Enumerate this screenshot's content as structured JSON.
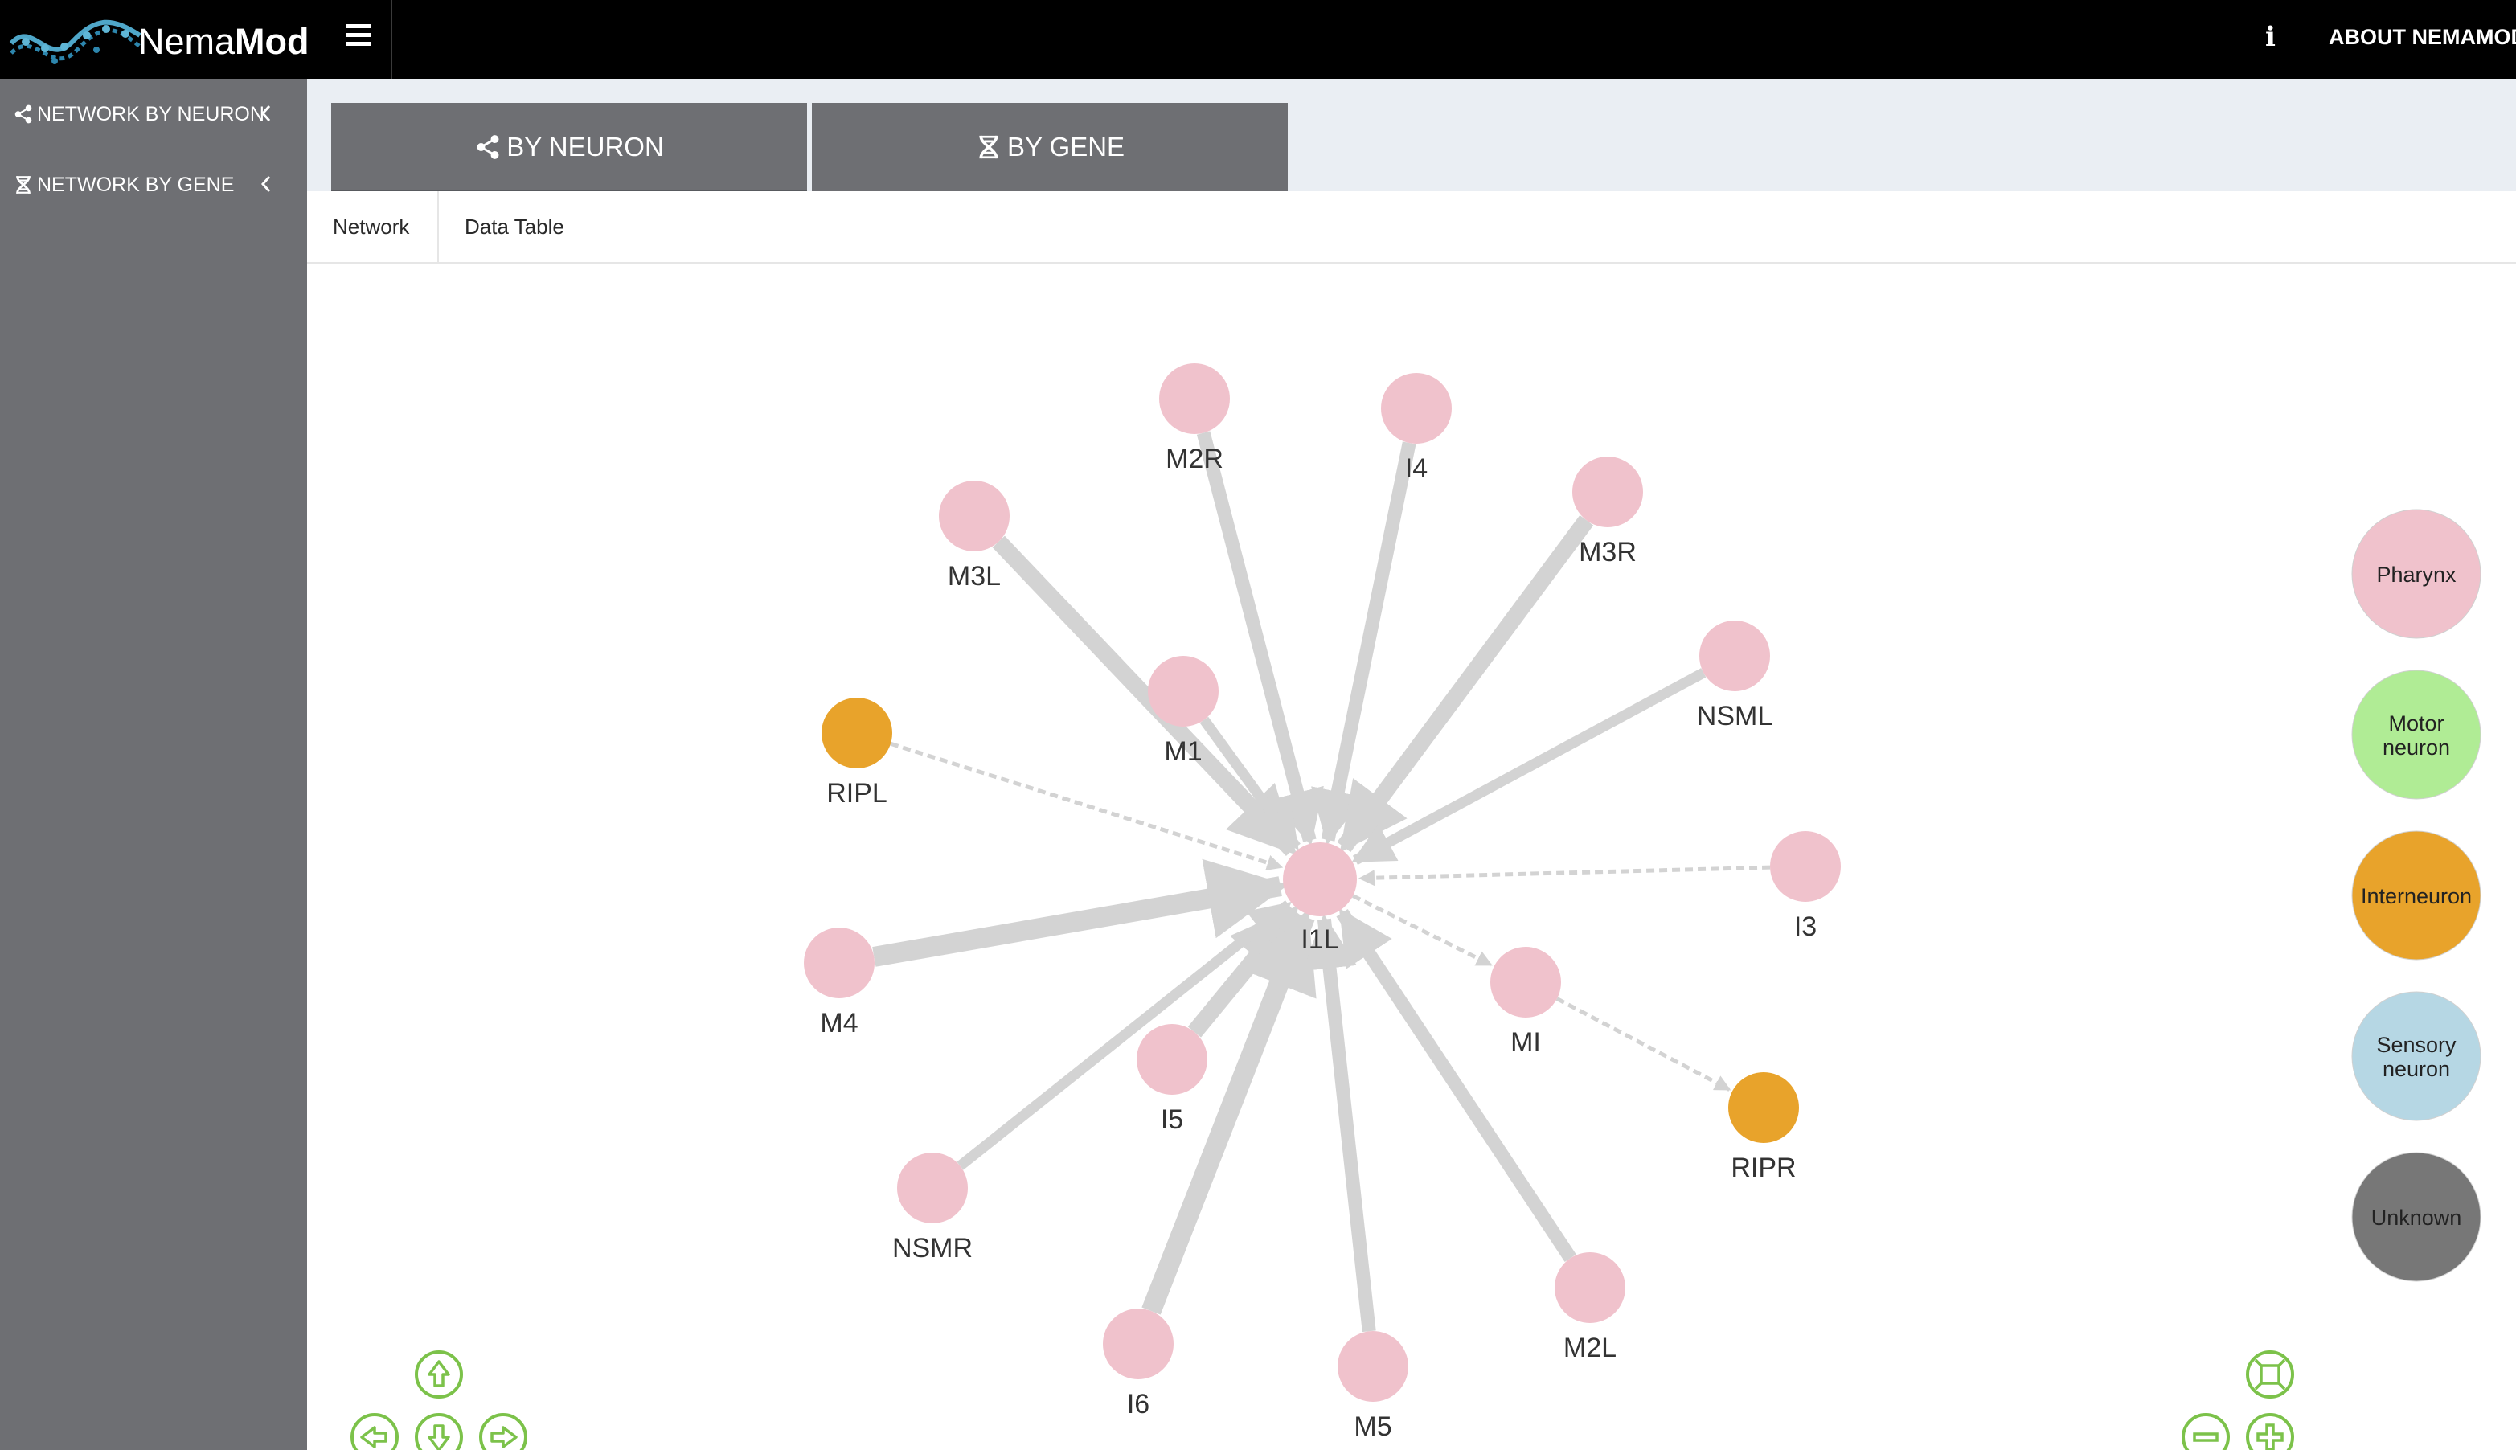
{
  "header": {
    "logo_regular": "Nema",
    "logo_bold": "Mod",
    "info_icon_char": "i",
    "about_label": "ABOUT NEMAMOD"
  },
  "sidebar": {
    "items": [
      {
        "label": "NETWORK BY NEURON",
        "icon": "share-icon"
      },
      {
        "label": "NETWORK BY GENE",
        "icon": "dna-icon"
      }
    ]
  },
  "main_tabs": [
    {
      "label": "BY NEURON",
      "icon": "share-icon",
      "active": true
    },
    {
      "label": "BY GENE",
      "icon": "dna-icon",
      "active": false
    }
  ],
  "sub_tabs": [
    {
      "label": "Network",
      "active": true
    },
    {
      "label": "Data Table",
      "active": false
    }
  ],
  "colors": {
    "pharynx": "#f0c2cc",
    "motor": "#b0ec95",
    "interneuron": "#e8a32b",
    "sensory": "#b6d7e4",
    "unknown": "#777777",
    "edge": "#d3d3d3",
    "sidebar": "#6e6f73",
    "nav_icon": "#7cc24a"
  },
  "network": {
    "center": "I1L",
    "nodes": [
      {
        "id": "I1L",
        "type": "pharynx"
      },
      {
        "id": "M2R",
        "type": "pharynx"
      },
      {
        "id": "I4",
        "type": "pharynx"
      },
      {
        "id": "M3L",
        "type": "pharynx"
      },
      {
        "id": "M3R",
        "type": "pharynx"
      },
      {
        "id": "NSML",
        "type": "pharynx"
      },
      {
        "id": "M1",
        "type": "pharynx"
      },
      {
        "id": "RIPL",
        "type": "interneuron"
      },
      {
        "id": "I3",
        "type": "pharynx"
      },
      {
        "id": "M4",
        "type": "pharynx"
      },
      {
        "id": "MI",
        "type": "pharynx"
      },
      {
        "id": "I5",
        "type": "pharynx"
      },
      {
        "id": "RIPR",
        "type": "interneuron"
      },
      {
        "id": "NSMR",
        "type": "pharynx"
      },
      {
        "id": "I6",
        "type": "pharynx"
      },
      {
        "id": "M5",
        "type": "pharynx"
      },
      {
        "id": "M2L",
        "type": "pharynx"
      }
    ],
    "edges": [
      {
        "from": "M2R",
        "to": "I1L",
        "style": "solid",
        "weight": 3
      },
      {
        "from": "I4",
        "to": "I1L",
        "style": "solid",
        "weight": 3
      },
      {
        "from": "M3L",
        "to": "I1L",
        "style": "solid",
        "weight": 4
      },
      {
        "from": "M3R",
        "to": "I1L",
        "style": "solid",
        "weight": 4
      },
      {
        "from": "NSML",
        "to": "I1L",
        "style": "solid",
        "weight": 2
      },
      {
        "from": "M1",
        "to": "I1L",
        "style": "solid",
        "weight": 2
      },
      {
        "from": "RIPL",
        "to": "I1L",
        "style": "dashed",
        "weight": 1
      },
      {
        "from": "I3",
        "to": "I1L",
        "style": "dashed",
        "weight": 1
      },
      {
        "from": "M4",
        "to": "I1L",
        "style": "solid",
        "weight": 5
      },
      {
        "from": "I1L",
        "to": "MI",
        "style": "dashed",
        "weight": 1
      },
      {
        "from": "MI",
        "to": "RIPR",
        "style": "dashed",
        "weight": 1
      },
      {
        "from": "I5",
        "to": "I1L",
        "style": "solid",
        "weight": 4
      },
      {
        "from": "NSMR",
        "to": "I1L",
        "style": "solid",
        "weight": 2
      },
      {
        "from": "I6",
        "to": "I1L",
        "style": "solid",
        "weight": 5
      },
      {
        "from": "M5",
        "to": "I1L",
        "style": "solid",
        "weight": 3
      },
      {
        "from": "M2L",
        "to": "I1L",
        "style": "solid",
        "weight": 3
      }
    ]
  },
  "legend": [
    {
      "label": "Pharynx",
      "key": "pharynx"
    },
    {
      "label": "Motor neuron",
      "key": "motor"
    },
    {
      "label": "Interneuron",
      "key": "interneuron"
    },
    {
      "label": "Sensory neuron",
      "key": "sensory"
    },
    {
      "label": "Unknown",
      "key": "unknown"
    }
  ],
  "nav_controls": [
    "pan-up-icon",
    "pan-left-icon",
    "pan-down-icon",
    "pan-right-icon",
    "fit-icon",
    "zoom-out-icon",
    "zoom-in-icon"
  ]
}
